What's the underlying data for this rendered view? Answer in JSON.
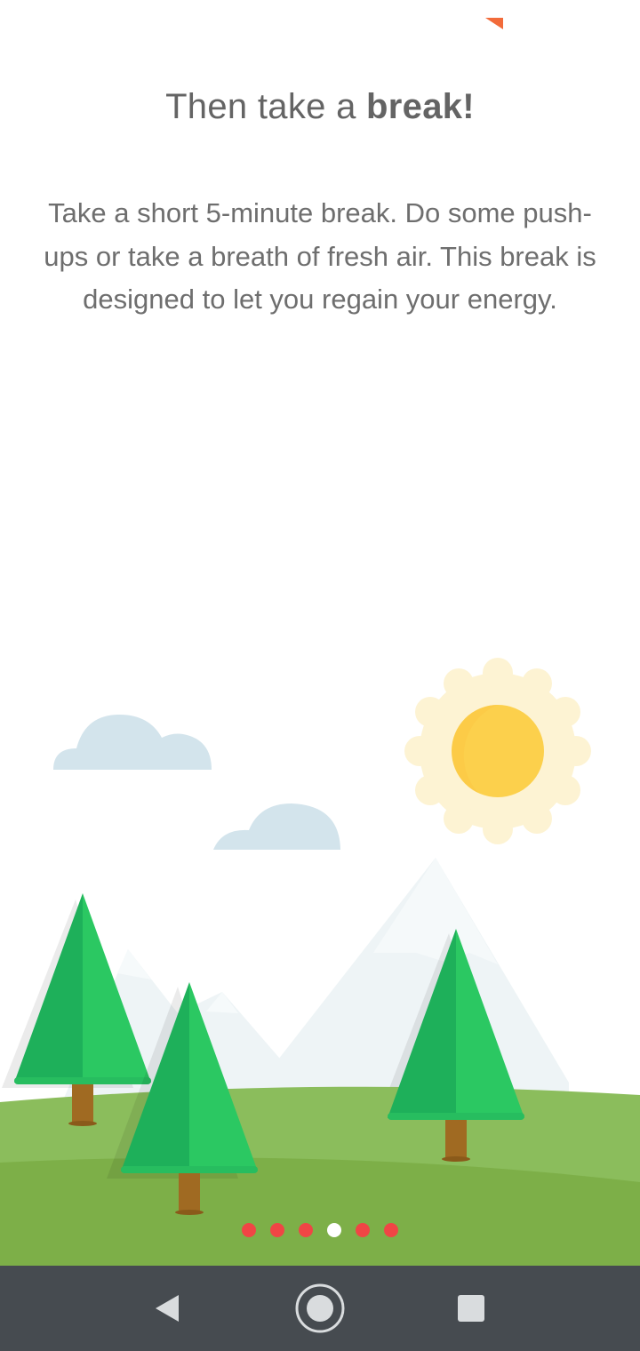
{
  "onboarding": {
    "title_prefix": "Then take a ",
    "title_bold": "break!",
    "description": "Take a short 5-minute break. Do some push-ups or take a breath of fresh air. This break is designed to let you regain your energy.",
    "page_count": 6,
    "current_page": 4
  },
  "colors": {
    "accent_orange": "#f26b3a",
    "dot_inactive": "#f04545",
    "dot_active": "#ffffff",
    "grass_back": "#8bbd5c",
    "grass_front": "#7daf48",
    "tree_dark": "#1eb05a",
    "tree_light": "#2bc862",
    "trunk": "#a06a22",
    "sun_core": "#fcd04c",
    "sun_halo": "#fdf3d3",
    "cloud": "#d3e4ec",
    "mountain": "#eef4f6",
    "nav_bar": "#464b50"
  },
  "nav": {
    "back_icon": "back-triangle-icon",
    "home_icon": "home-circle-icon",
    "recents_icon": "recents-square-icon"
  }
}
